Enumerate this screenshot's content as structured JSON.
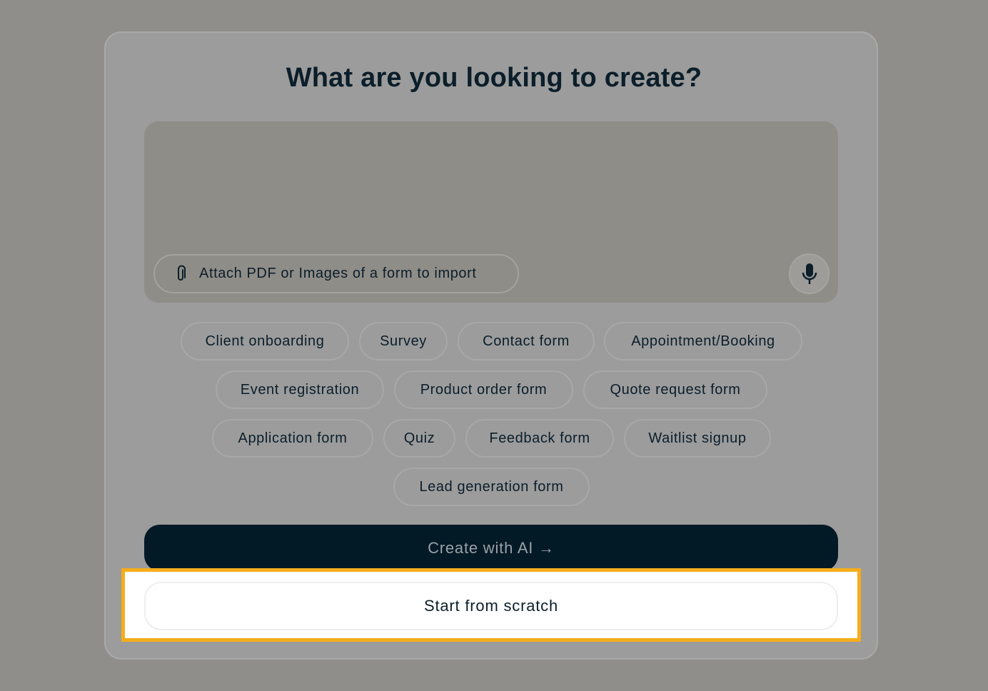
{
  "dialog": {
    "title": "What are you looking to create?",
    "attach_label": "Attach PDF or Images of a form to import",
    "chips": [
      "Client onboarding",
      "Survey",
      "Contact form",
      "Appointment/Booking",
      "Event registration",
      "Product order form",
      "Quote request form",
      "Application form",
      "Quiz",
      "Feedback form",
      "Waitlist signup",
      "Lead generation form"
    ],
    "create_label": "Create with AI →",
    "scratch_label": "Start from scratch"
  },
  "icons": {
    "attach": "paperclip-icon",
    "mic": "microphone-icon"
  },
  "colors": {
    "overlay": "#8f8e8a",
    "primary_button": "#021926",
    "highlight": "#f6ad1a"
  }
}
